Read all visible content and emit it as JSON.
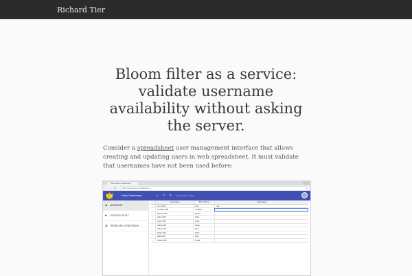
{
  "site": {
    "brand": "Richard Tier"
  },
  "article": {
    "title": "Bloom filter as a service: validate username availability without asking the server.",
    "intro_before": "Consider a ",
    "intro_link": "spreadsheet",
    "intro_after": " user management interface that allows creating and updating users in web spreadsheet. It must validate that usernames have not been used before:"
  },
  "screenshot": {
    "tab_title": "Monsoftex Dashboard",
    "url": "dash.monsoftex.co.uk/#/users",
    "app_title": "Class Dashboard",
    "toolbar_label": "GET TEMPLATES",
    "sidebar": [
      {
        "label": "LEARNERS",
        "icon": "group-icon",
        "active": true
      },
      {
        "label": "YOUR ACCOUNT",
        "icon": "account-icon",
        "active": false
      },
      {
        "label": "TERMS AND CONDITIONS",
        "icon": "document-icon",
        "active": false
      }
    ],
    "columns": [
      "Username",
      "First Name",
      "Last Name"
    ],
    "rows": [
      [
        "Cee-109",
        "Cee",
        "Jay"
      ],
      [
        "Joshua-109",
        "Joshua",
        ""
      ],
      [
        "Ewan-109",
        "Ewan",
        ""
      ],
      [
        "Vani-109",
        "Vani",
        ""
      ],
      [
        "Lucy-109",
        "Lucy",
        ""
      ],
      [
        "Sara-109",
        "Sara",
        ""
      ],
      [
        "Alina-109",
        "Mia",
        ""
      ],
      [
        "Niah-109",
        "Niah",
        ""
      ],
      [
        "Mia-109",
        "Mia",
        ""
      ],
      [
        "Jules-109",
        "Jules",
        ""
      ]
    ],
    "colors": {
      "appbar": "#3f51b5",
      "selection": "#4a78e0"
    }
  }
}
